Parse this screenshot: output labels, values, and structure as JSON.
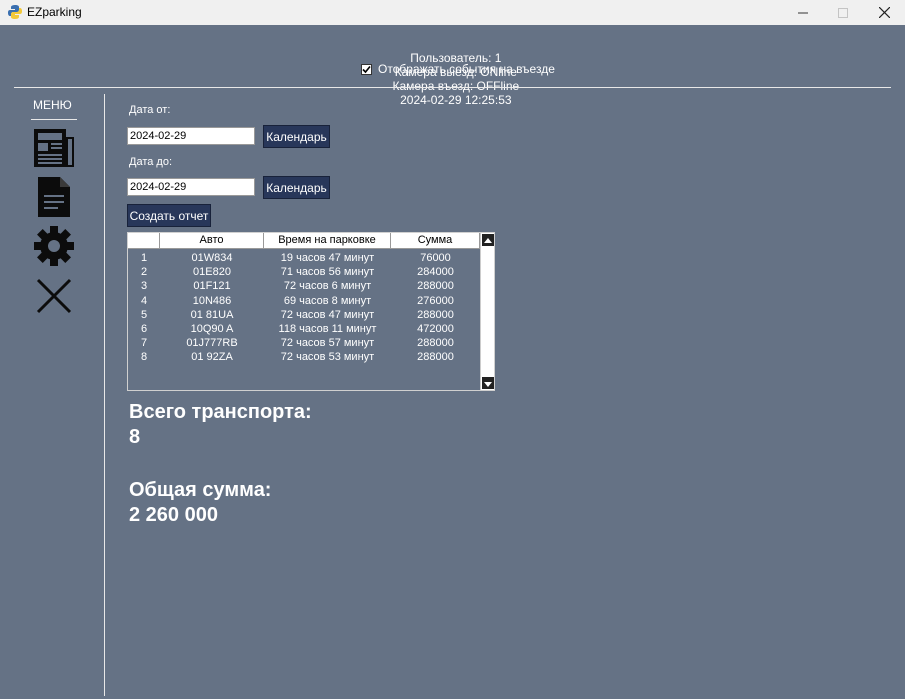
{
  "window": {
    "title": "EZparking"
  },
  "status": {
    "user": "Пользователь: 1",
    "exit_camera": "Камера выезд: ONline",
    "entry_camera": "Камера въезд: OFFline",
    "datetime": "2024-02-29 12:25:53",
    "show_entry_events_label": "Отображать события на въезде",
    "show_entry_events_checked": true
  },
  "menu": {
    "label": "МЕНЮ",
    "items": [
      "newspaper-icon",
      "document-icon",
      "gear-icon",
      "close-icon"
    ]
  },
  "form": {
    "date_from_label": "Дата от:",
    "date_from_value": "2024-02-29",
    "date_to_label": "Дата до:",
    "date_to_value": "2024-02-29",
    "calendar_button": "Календарь",
    "create_report_button": "Создать отчет"
  },
  "table": {
    "columns": [
      "",
      "Авто",
      "Время на парковке",
      "Сумма"
    ],
    "rows": [
      {
        "n": "1",
        "car": "01W834",
        "time": "19 часов 47 минут",
        "sum": "76000"
      },
      {
        "n": "2",
        "car": "01E820",
        "time": "71 часов 56 минут",
        "sum": "284000"
      },
      {
        "n": "3",
        "car": "01F121",
        "time": "72 часов 6 минут",
        "sum": "288000"
      },
      {
        "n": "4",
        "car": "10N486",
        "time": "69 часов 8 минут",
        "sum": "276000"
      },
      {
        "n": "5",
        "car": "01 81UA",
        "time": "72 часов 47 минут",
        "sum": "288000"
      },
      {
        "n": "6",
        "car": "10Q90 A",
        "time": "118 часов 11 минут",
        "sum": "472000"
      },
      {
        "n": "7",
        "car": "01J777RB",
        "time": "72 часов 57 минут",
        "sum": "288000"
      },
      {
        "n": "8",
        "car": "01 92ZA",
        "time": "72 часов 53 минут",
        "sum": "288000"
      }
    ]
  },
  "totals": {
    "vehicles_label": "Всего транспорта:",
    "vehicles_value": "8",
    "sum_label": "Общая сумма:",
    "sum_value": "2 260 000"
  }
}
